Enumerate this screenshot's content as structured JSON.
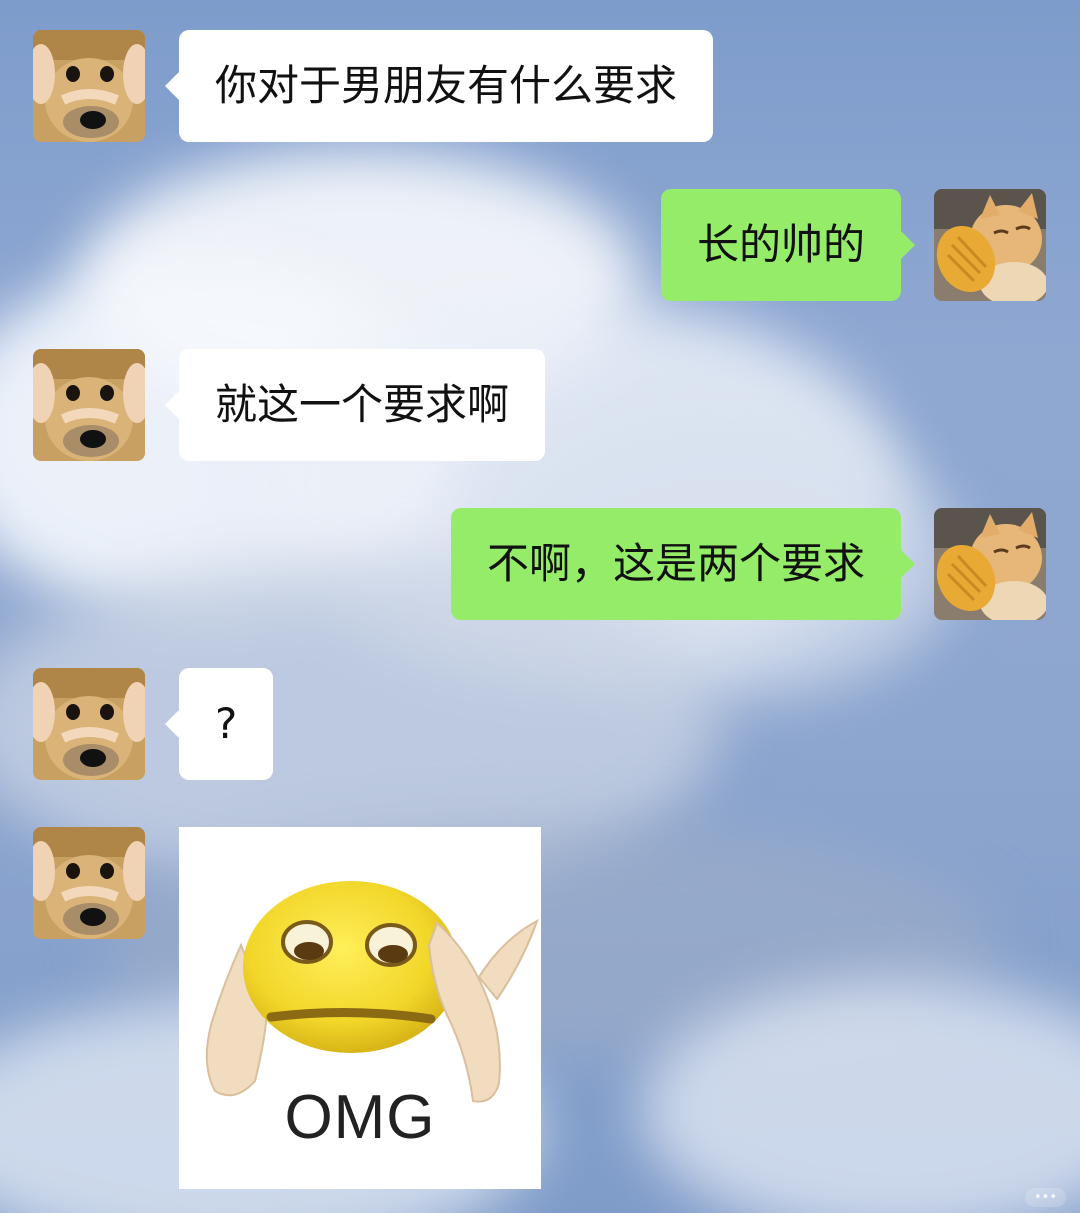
{
  "chat": {
    "messages": [
      {
        "side": "in",
        "kind": "text",
        "text": "你对于男朋友有什么要求",
        "avatar": "dog-avatar"
      },
      {
        "side": "out",
        "kind": "text",
        "text": "长的帅的",
        "avatar": "cat-avatar"
      },
      {
        "side": "in",
        "kind": "text",
        "text": "就这一个要求啊",
        "avatar": "dog-avatar"
      },
      {
        "side": "out",
        "kind": "text",
        "text": "不啊，这是两个要求",
        "avatar": "cat-avatar"
      },
      {
        "side": "in",
        "kind": "text",
        "text": "?",
        "avatar": "dog-avatar"
      },
      {
        "side": "in",
        "kind": "sticker",
        "sticker_text": "OMG",
        "avatar": "dog-avatar"
      }
    ]
  },
  "colors": {
    "incoming_bubble": "#ffffff",
    "outgoing_bubble": "#95ec69",
    "sky": "#8da6cf"
  }
}
